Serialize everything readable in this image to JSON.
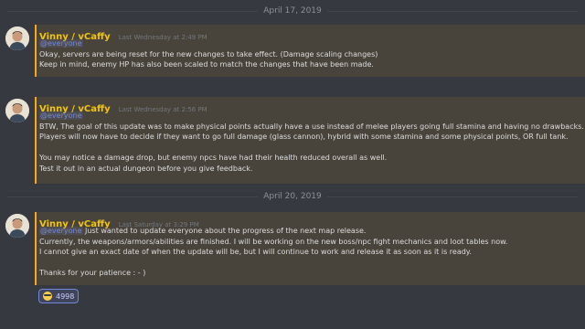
{
  "dividers": [
    {
      "date": "April 17, 2019"
    },
    {
      "date": "April 20, 2019"
    }
  ],
  "messages": [
    {
      "author": "Vinny / vCaffy",
      "timestamp": "Last Wednesday at 2:49 PM",
      "mention": "@everyone",
      "lines": [
        "Okay, servers are being reset for the new changes to take effect. (Damage scaling changes)",
        "Keep in mind, enemy HP has also been scaled to match the changes that have been made."
      ]
    },
    {
      "author": "Vinny / vCaffy",
      "timestamp": "Last Wednesday at 2:56 PM",
      "mention": "@everyone",
      "lines": [
        "BTW, The goal of this update was to make physical points actually have a use instead of melee players going full stamina and having no drawbacks.",
        "Players will now have to decide if they want to go full damage (glass cannon), hybrid with some stamina and some physical points, OR full tank.",
        "",
        "You may notice a damage drop, but enemy npcs have had their health reduced overall as well.",
        "Test it out in an actual dungeon before you give feedback."
      ]
    },
    {
      "author": "Vinny / vCaffy",
      "timestamp": "Last Saturday at 3:29 PM",
      "mention": "@everyone",
      "first_line_rest": " Just wanted to update everyone about the progress of the next map release.",
      "lines": [
        "Currently, the weapons/armors/abilities are finished. I will be working on the new boss/npc fight mechanics and loot tables now.",
        "I cannot give an exact date of when the update will be, but I will continue to work and release it as soon as it is ready.",
        "",
        "Thanks for your patience : - )"
      ],
      "reaction": {
        "emoji": "neutral-face-icon",
        "count": "4998"
      }
    }
  ],
  "colors": {
    "background": "#36393f",
    "author": "#f1c40f",
    "mention": "#7289da",
    "mention_highlight": "#faa61a",
    "timestamp": "#72767d"
  }
}
